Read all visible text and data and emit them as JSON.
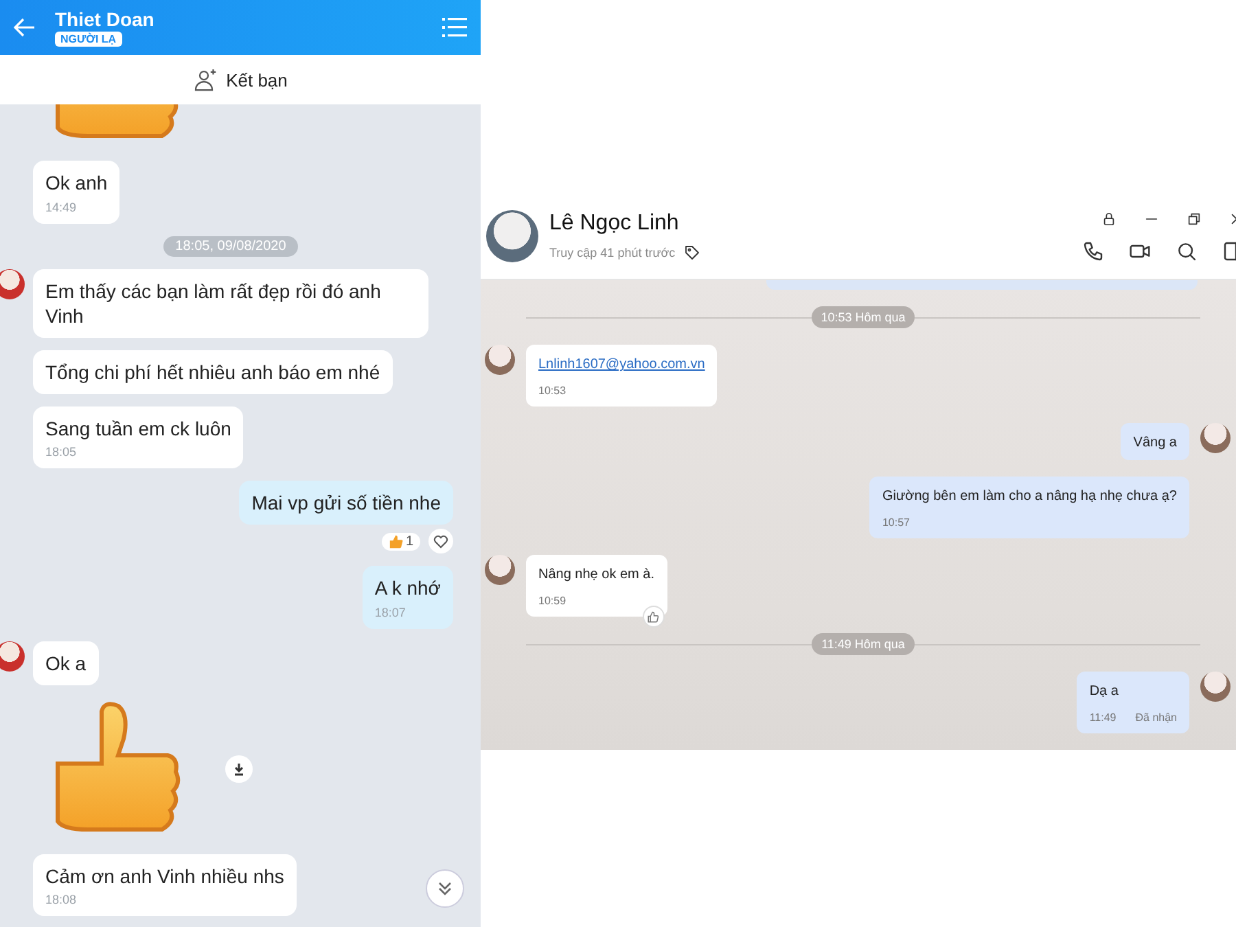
{
  "mobile_chat": {
    "header": {
      "title": "Thiet Doan",
      "badge": "NGƯỜI LẠ"
    },
    "add_friend": {
      "label": "Kết bạn"
    },
    "messages": [
      {
        "kind": "sticker"
      },
      {
        "kind": "text",
        "outgoing": false,
        "avatar": false,
        "text": "Ok anh",
        "time": "14:49"
      },
      {
        "kind": "divider",
        "label": "18:05, 09/08/2020"
      },
      {
        "kind": "text",
        "outgoing": false,
        "avatar": true,
        "text": "Em thấy các bạn làm rất đẹp rồi đó anh Vinh"
      },
      {
        "kind": "text",
        "outgoing": false,
        "avatar": false,
        "text": "Tổng chi phí hết nhiêu anh báo em nhé"
      },
      {
        "kind": "text",
        "outgoing": false,
        "avatar": false,
        "text": "Sang tuần em ck luôn",
        "time": "18:05"
      },
      {
        "kind": "text",
        "outgoing": true,
        "avatar": false,
        "text": "Mai vp gửi số tiền nhe",
        "reaction_count": "1"
      },
      {
        "kind": "text",
        "outgoing": true,
        "avatar": false,
        "text": "A k nhớ",
        "time": "18:07"
      },
      {
        "kind": "text",
        "outgoing": false,
        "avatar": true,
        "text": "Ok a"
      },
      {
        "kind": "sticker"
      },
      {
        "kind": "text",
        "outgoing": false,
        "avatar": false,
        "text": "Cảm ơn anh Vinh nhiều nhs",
        "time": "18:08"
      }
    ]
  },
  "desktop_chat": {
    "header": {
      "name": "Lê Ngọc Linh",
      "status": "Truy cập 41 phút trước"
    },
    "messages": [
      {
        "kind": "divider",
        "label": "10:53 Hôm qua"
      },
      {
        "kind": "link",
        "outgoing": false,
        "avatar": true,
        "text": "Lnlinh1607@yahoo.com.vn",
        "time": "10:53"
      },
      {
        "kind": "text",
        "outgoing": true,
        "avatar": true,
        "text": "Vâng a"
      },
      {
        "kind": "text",
        "outgoing": true,
        "avatar": false,
        "text": "Giường bên em làm cho a nâng hạ nhẹ chưa ạ?",
        "time": "10:57"
      },
      {
        "kind": "text",
        "outgoing": false,
        "avatar": true,
        "text": "Nâng nhẹ ok em à.",
        "time": "10:59",
        "like_button": true
      },
      {
        "kind": "divider",
        "label": "11:49 Hôm qua"
      },
      {
        "kind": "text",
        "outgoing": true,
        "avatar": true,
        "text": "Dạ a",
        "time": "11:49",
        "receipt": "Đã nhận"
      }
    ]
  }
}
